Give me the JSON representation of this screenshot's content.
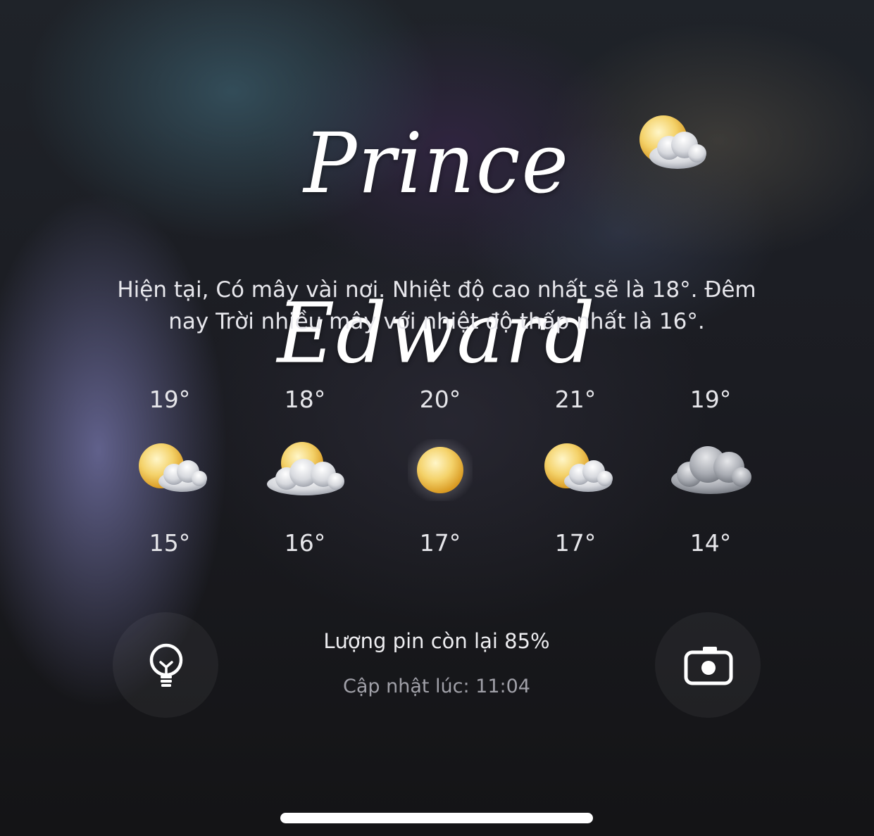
{
  "location": {
    "name": "Prince Edward"
  },
  "current": {
    "icon": "partly-cloudy-icon",
    "summary": "Hiện tại, Có mây vài nơi. Nhiệt độ cao nhất sẽ là 18°. Đêm nay Trời nhiều mây với nhiệt độ thấp nhất là 16°."
  },
  "forecast": [
    {
      "high": "19°",
      "low": "15°",
      "icon": "partly-cloudy-icon"
    },
    {
      "high": "18°",
      "low": "16°",
      "icon": "mostly-cloudy-icon"
    },
    {
      "high": "20°",
      "low": "17°",
      "icon": "hazy-sun-icon"
    },
    {
      "high": "21°",
      "low": "17°",
      "icon": "partly-cloudy-icon"
    },
    {
      "high": "19°",
      "low": "14°",
      "icon": "cloudy-icon"
    }
  ],
  "footer": {
    "battery_text": "Lượng pin còn lại 85%",
    "updated_text": "Cập nhật lúc: 11:04",
    "left_button_icon": "flashlight-bulb-icon",
    "right_button_icon": "camera-icon"
  },
  "colors": {
    "text": "#ffffff",
    "muted_text": "#a0a0a8",
    "sun": "#f2c94c"
  }
}
